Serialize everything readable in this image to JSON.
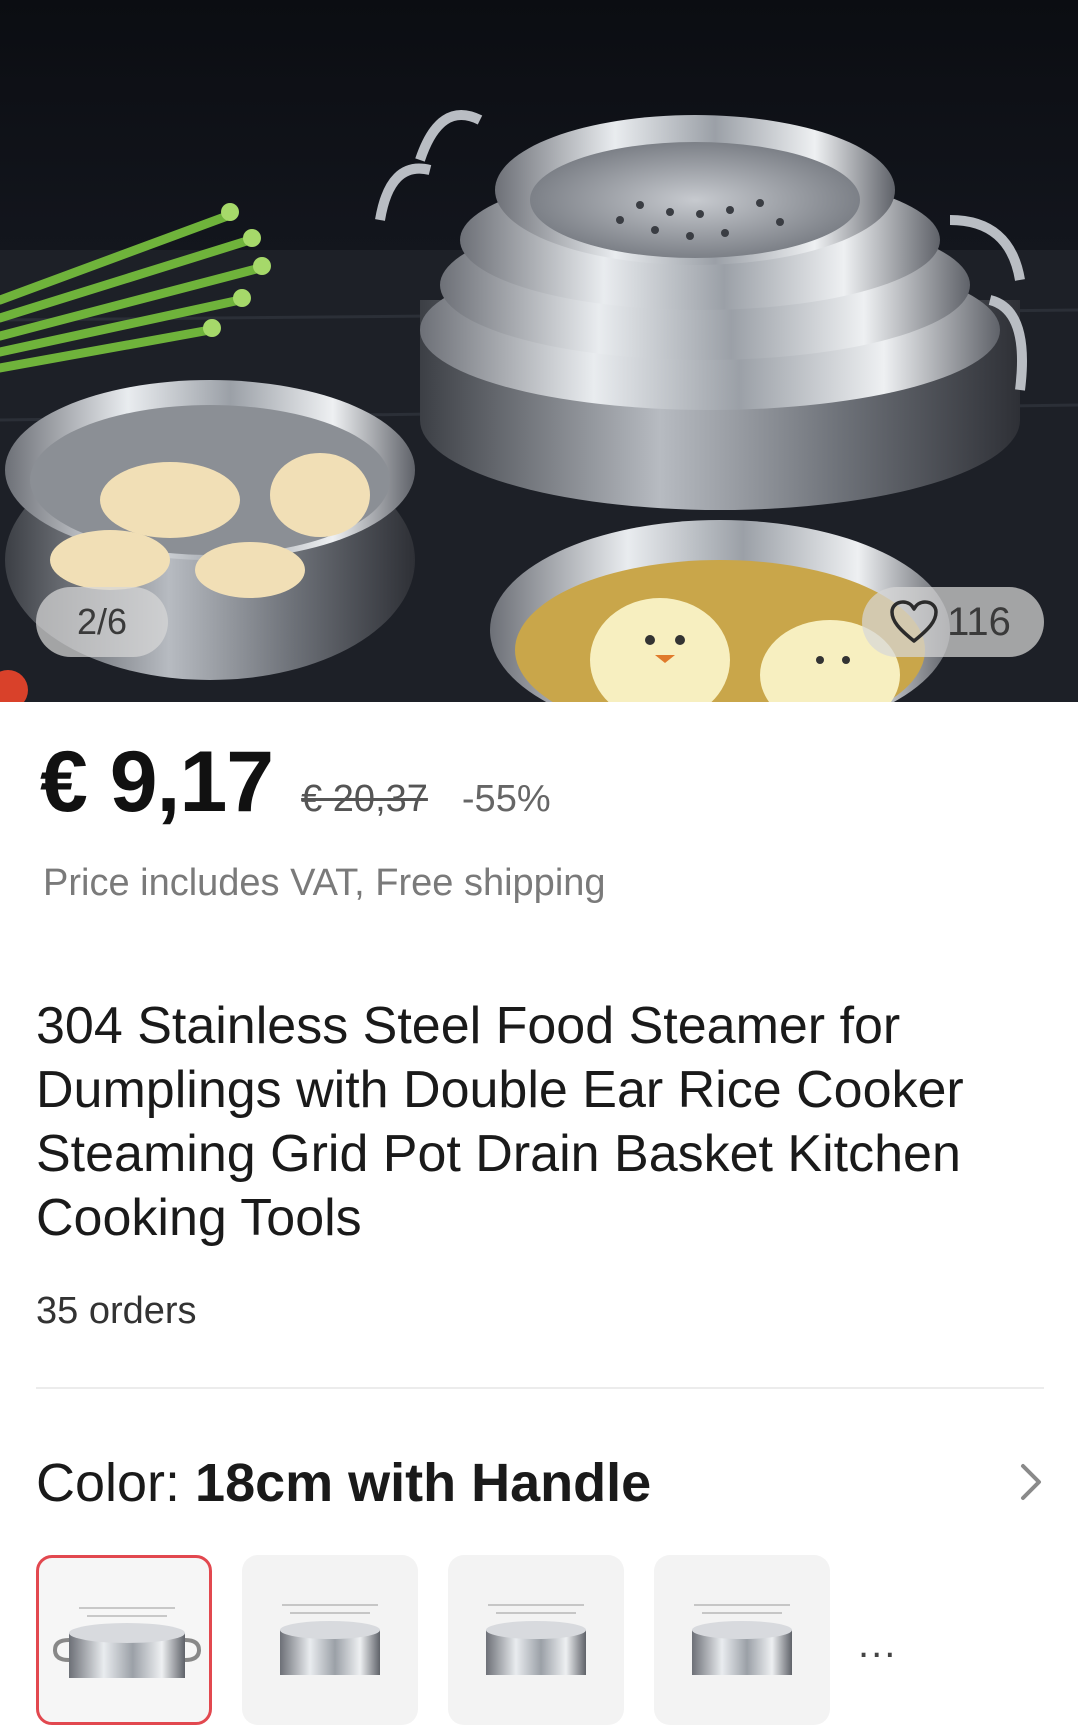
{
  "gallery": {
    "counter": "2/6",
    "wishlist_count": "116"
  },
  "price": {
    "current": "€ 9,17",
    "original": "€ 20,37",
    "discount": "-55%",
    "vat_note": "Price includes VAT, Free shipping"
  },
  "product": {
    "title": "304 Stainless Steel Food Steamer for Dumplings with Double Ear Rice Cooker Steaming Grid Pot Drain Basket Kitchen Cooking Tools",
    "orders": "35 orders"
  },
  "variant": {
    "label": "Color: ",
    "selected_value": "18cm with Handle",
    "more": "..."
  },
  "colors": {
    "accent_selected": "#e2484f"
  }
}
